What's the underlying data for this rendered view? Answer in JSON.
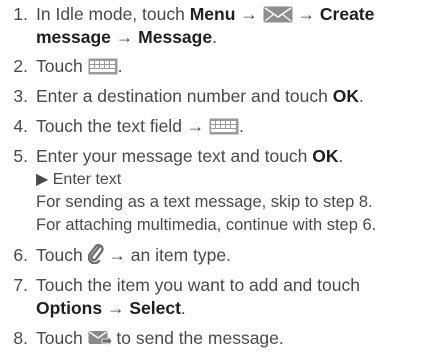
{
  "steps": [
    {
      "num": "1.",
      "parts": [
        "In Idle mode, touch ",
        "Menu",
        " → ",
        "[message-icon]",
        " → ",
        "Create",
        "message",
        " → ",
        "Message",
        "."
      ]
    },
    {
      "num": "2.",
      "a": "Touch ",
      "b": "."
    },
    {
      "num": "3.",
      "a": "Enter a destination number and touch ",
      "bold": "OK",
      "b": "."
    },
    {
      "num": "4.",
      "a": "Touch the text field → ",
      "b": "."
    },
    {
      "num": "5.",
      "a": "Enter your message text and touch ",
      "bold": "OK",
      "b": "."
    },
    {
      "num": "6.",
      "a": "Touch ",
      "b": " → an item type."
    },
    {
      "num": "7.",
      "line1": "Touch the item you want to add and touch",
      "bold1": "Options",
      "arrow": " → ",
      "bold2": "Select",
      "end": "."
    },
    {
      "num": "8.",
      "a": "Touch ",
      "b": " to send the message."
    }
  ],
  "step1": {
    "a": "In Idle mode, touch ",
    "menu": "Menu",
    "arrow1": " → ",
    "arrow2": " → ",
    "create": "Create",
    "message": "message",
    "arrow3": " → ",
    "message2": "Message",
    "end": "."
  },
  "step5_sub": {
    "bullet": "▶ Enter text",
    "line1": "For sending as a text message, skip to step 8.",
    "line2": "For attaching multimedia, continue with step 6."
  },
  "icons": {
    "message": "message-envelope-icon",
    "keypad": "keypad-icon",
    "attach": "paperclip-icon",
    "send": "send-message-icon"
  },
  "colors": {
    "text": "#4a4a4a",
    "bold": "#1f1f1f",
    "icon": "#8a8a8a"
  }
}
